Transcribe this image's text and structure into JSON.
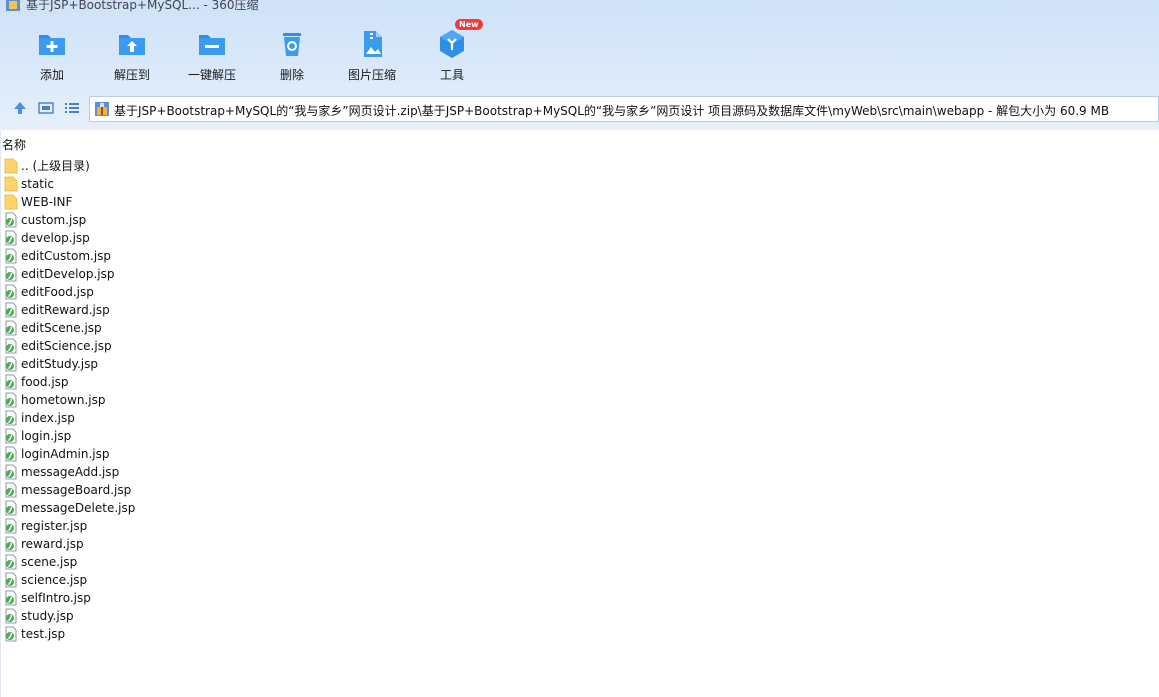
{
  "window": {
    "title": "基于JSP+Bootstrap+MySQL... - 360压缩"
  },
  "toolbar": {
    "buttons": [
      {
        "label": "添加",
        "icon": "add-folder-icon"
      },
      {
        "label": "解压到",
        "icon": "extract-to-icon"
      },
      {
        "label": "一键解压",
        "icon": "one-click-extract-icon"
      },
      {
        "label": "删除",
        "icon": "delete-icon"
      },
      {
        "label": "图片压缩",
        "icon": "image-compress-icon"
      },
      {
        "label": "工具",
        "icon": "tools-icon"
      }
    ],
    "new_badge": "New"
  },
  "nav": {
    "icons": [
      "up-arrow-icon",
      "thumbnail-view-icon",
      "list-view-icon"
    ]
  },
  "address": {
    "path": "基于JSP+Bootstrap+MySQL的“我与家乡”网页设计.zip\\基于JSP+Bootstrap+MySQL的“我与家乡”网页设计 项目源码及数据库文件\\myWeb\\src\\main\\webapp - 解包大小为 60.9 MB"
  },
  "list": {
    "column_header": "名称",
    "items": [
      {
        "name": ".. (上级目录)",
        "type": "folder"
      },
      {
        "name": "static",
        "type": "folder"
      },
      {
        "name": "WEB-INF",
        "type": "folder"
      },
      {
        "name": "custom.jsp",
        "type": "file"
      },
      {
        "name": "develop.jsp",
        "type": "file"
      },
      {
        "name": "editCustom.jsp",
        "type": "file"
      },
      {
        "name": "editDevelop.jsp",
        "type": "file"
      },
      {
        "name": "editFood.jsp",
        "type": "file"
      },
      {
        "name": "editReward.jsp",
        "type": "file"
      },
      {
        "name": "editScene.jsp",
        "type": "file"
      },
      {
        "name": "editScience.jsp",
        "type": "file"
      },
      {
        "name": "editStudy.jsp",
        "type": "file"
      },
      {
        "name": "food.jsp",
        "type": "file"
      },
      {
        "name": "hometown.jsp",
        "type": "file"
      },
      {
        "name": "index.jsp",
        "type": "file"
      },
      {
        "name": "login.jsp",
        "type": "file"
      },
      {
        "name": "loginAdmin.jsp",
        "type": "file"
      },
      {
        "name": "messageAdd.jsp",
        "type": "file"
      },
      {
        "name": "messageBoard.jsp",
        "type": "file"
      },
      {
        "name": "messageDelete.jsp",
        "type": "file"
      },
      {
        "name": "register.jsp",
        "type": "file"
      },
      {
        "name": "reward.jsp",
        "type": "file"
      },
      {
        "name": "scene.jsp",
        "type": "file"
      },
      {
        "name": "science.jsp",
        "type": "file"
      },
      {
        "name": "selfIntro.jsp",
        "type": "file"
      },
      {
        "name": "study.jsp",
        "type": "file"
      },
      {
        "name": "test.jsp",
        "type": "file"
      }
    ]
  },
  "colors": {
    "toolbar_bg": "#dbe9fa",
    "icon_blue": "#2f8fe6",
    "folder_yellow": "#ffd56b",
    "new_badge": "#ef3b3b"
  }
}
